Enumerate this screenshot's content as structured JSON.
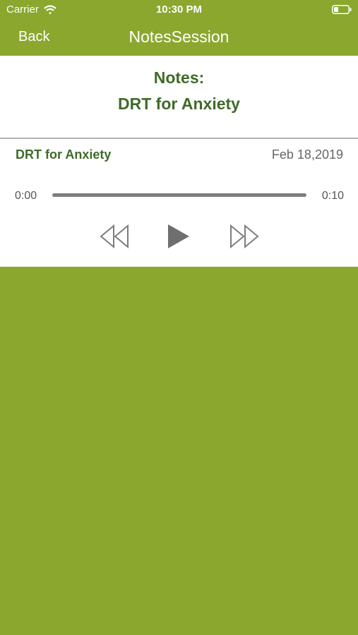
{
  "status_bar": {
    "carrier": "Carrier",
    "time": "10:30 PM",
    "icons": [
      "wifi-icon",
      "battery-icon"
    ]
  },
  "nav": {
    "back_label": "Back",
    "title": "NotesSession"
  },
  "header": {
    "line1": "Notes:",
    "line2": "DRT for Anxiety"
  },
  "player": {
    "title": "DRT for Anxiety",
    "date": "Feb 18,2019",
    "current_time": "0:00",
    "duration": "0:10",
    "progress_fraction": 0,
    "controls": [
      "rewind-icon",
      "play-icon",
      "fast-forward-icon"
    ]
  },
  "colors": {
    "accent": "#8ba72e",
    "title_green": "#3f6b2a",
    "control_gray": "#7d7d7d"
  }
}
